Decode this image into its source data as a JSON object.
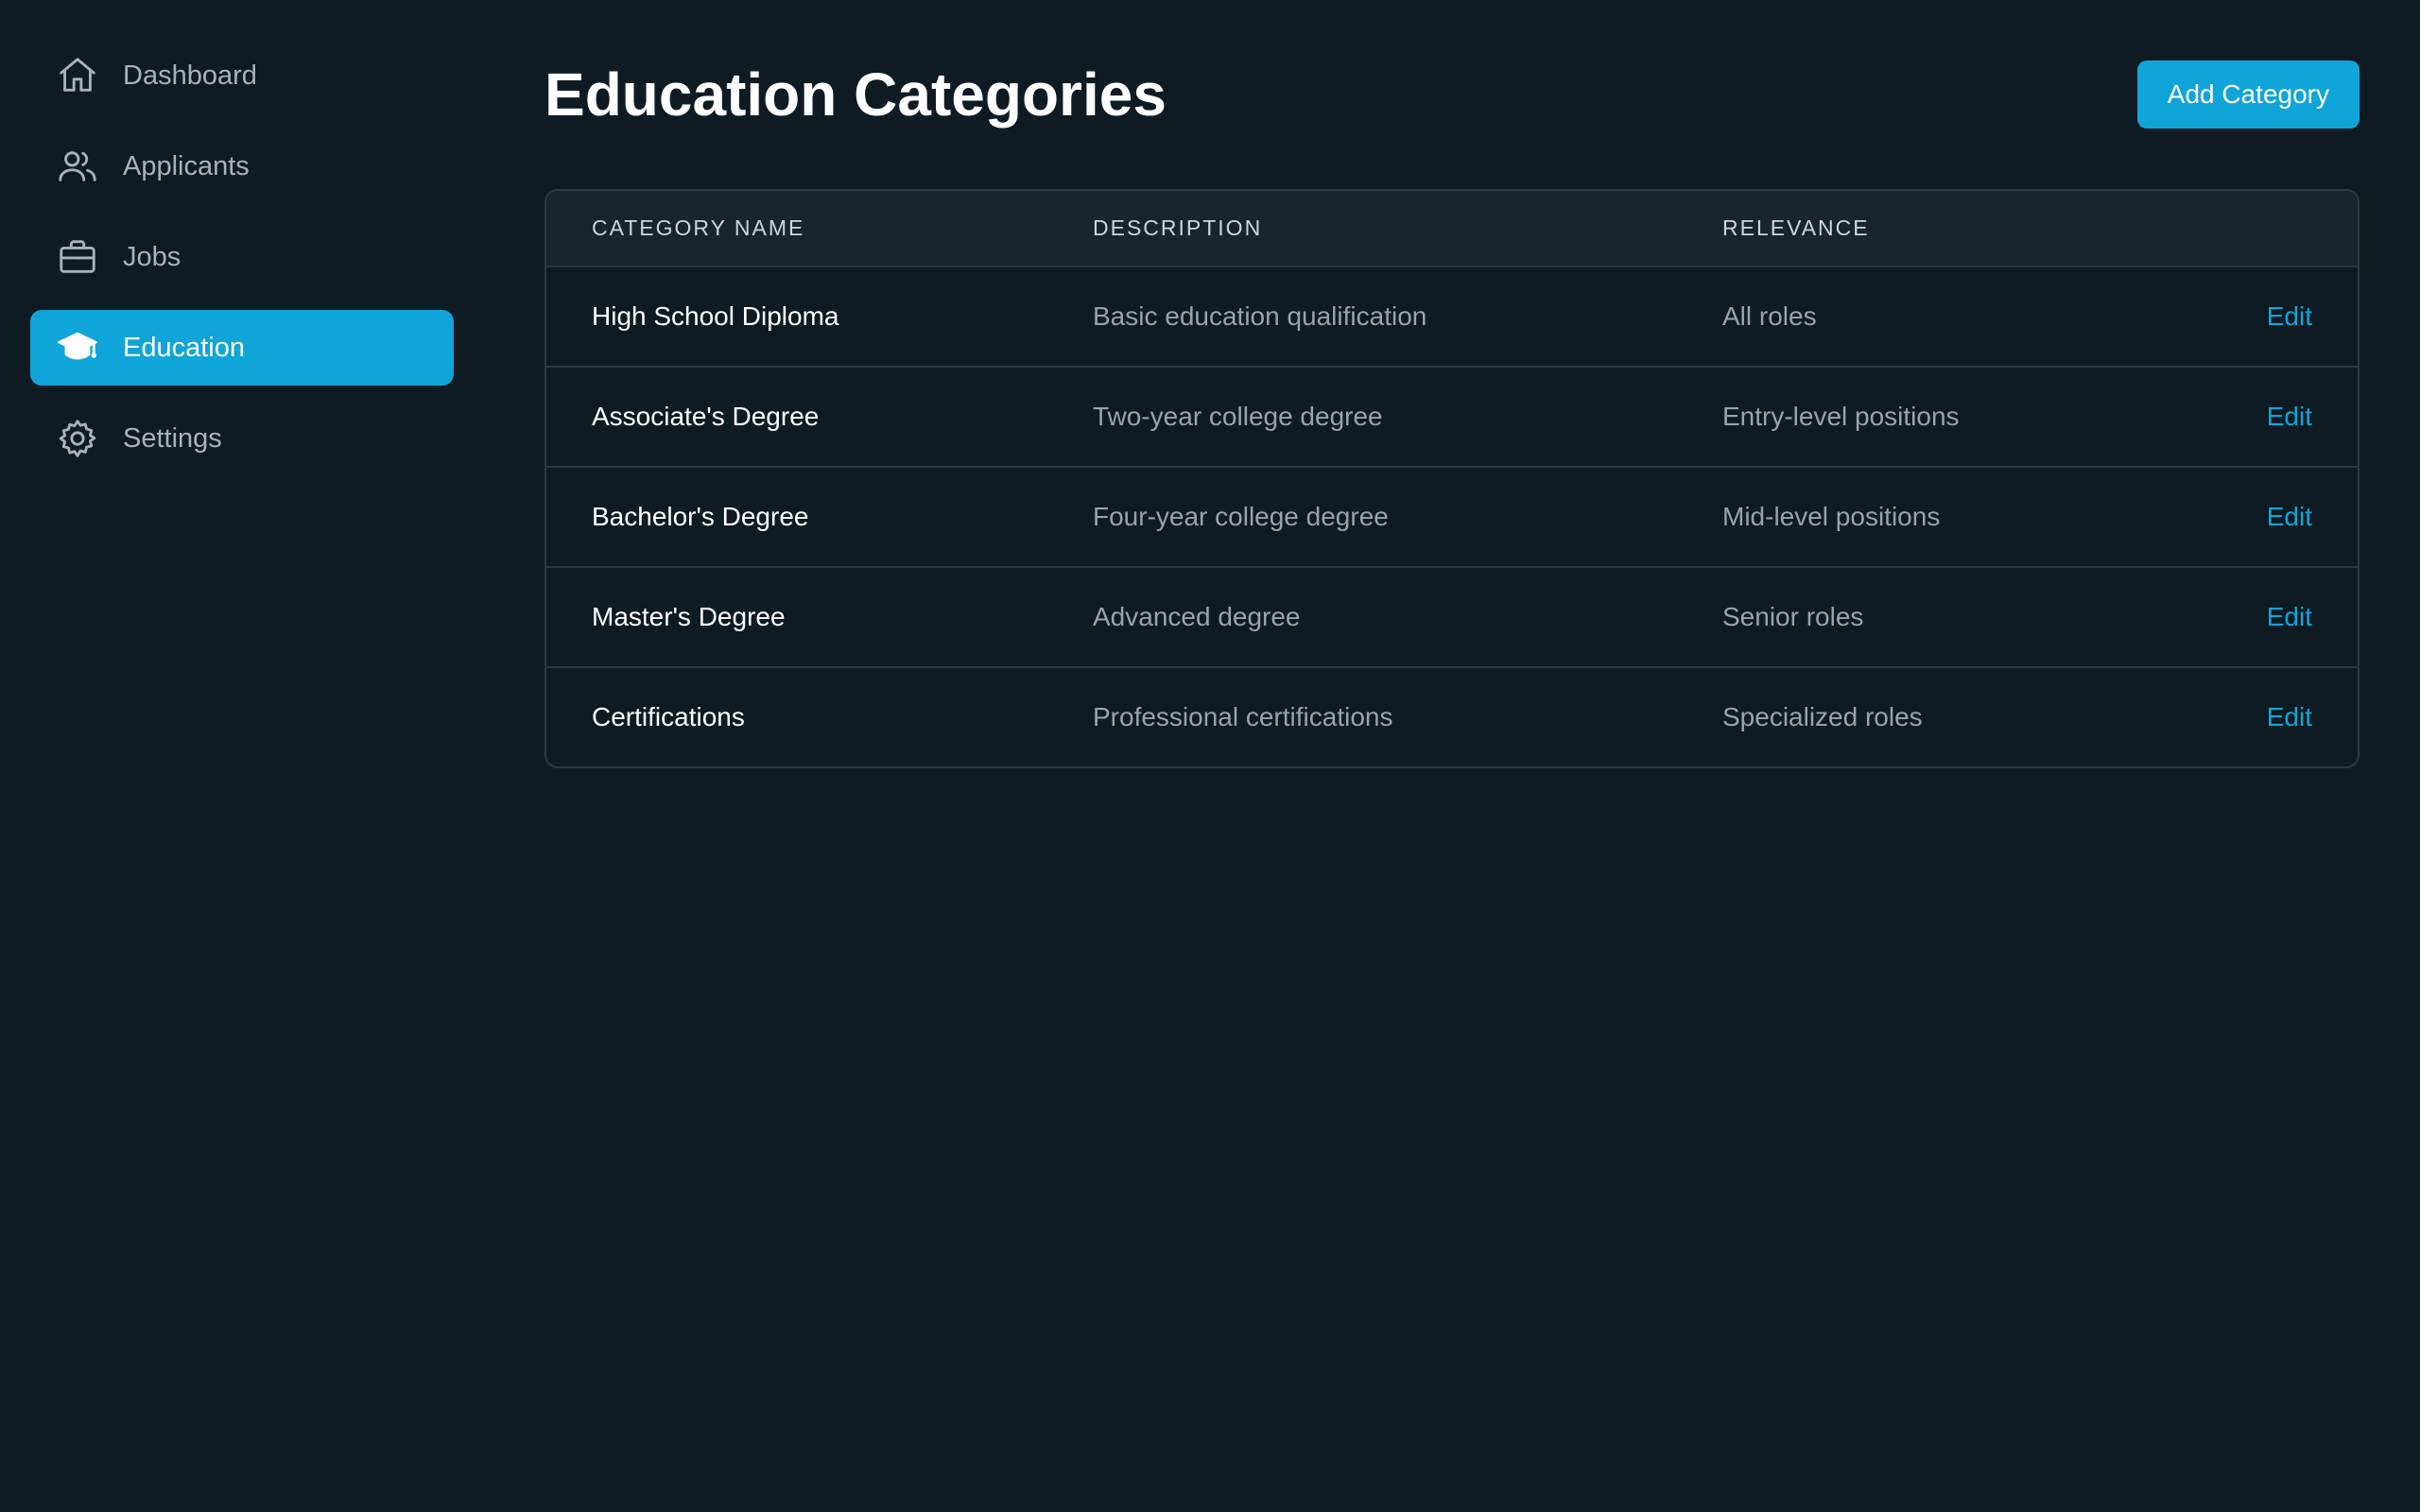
{
  "sidebar": {
    "items": [
      {
        "label": "Dashboard",
        "icon": "home-icon",
        "active": false
      },
      {
        "label": "Applicants",
        "icon": "users-icon",
        "active": false
      },
      {
        "label": "Jobs",
        "icon": "briefcase-icon",
        "active": false
      },
      {
        "label": "Education",
        "icon": "graduation-cap-icon",
        "active": true
      },
      {
        "label": "Settings",
        "icon": "gear-icon",
        "active": false
      }
    ]
  },
  "header": {
    "title": "Education Categories",
    "add_button_label": "Add Category"
  },
  "table": {
    "columns": [
      "CATEGORY NAME",
      "DESCRIPTION",
      "RELEVANCE",
      ""
    ],
    "rows": [
      {
        "name": "High School Diploma",
        "description": "Basic education qualification",
        "relevance": "All roles",
        "action": "Edit"
      },
      {
        "name": "Associate's Degree",
        "description": "Two-year college degree",
        "relevance": "Entry-level positions",
        "action": "Edit"
      },
      {
        "name": "Bachelor's Degree",
        "description": "Four-year college degree",
        "relevance": "Mid-level positions",
        "action": "Edit"
      },
      {
        "name": "Master's Degree",
        "description": "Advanced degree",
        "relevance": "Senior roles",
        "action": "Edit"
      },
      {
        "name": "Certifications",
        "description": "Professional certifications",
        "relevance": "Specialized roles",
        "action": "Edit"
      }
    ]
  },
  "colors": {
    "background": "#0f1b22",
    "accent": "#10a5d8",
    "header_row": "#18242f",
    "border": "#2a3844",
    "muted_text": "#97a3ae"
  }
}
